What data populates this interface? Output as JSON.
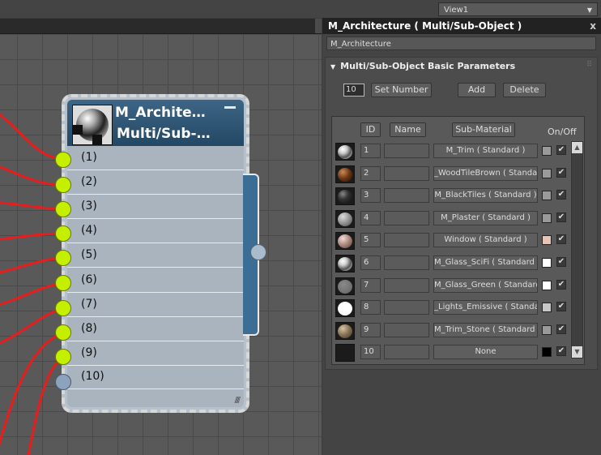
{
  "view_dropdown": {
    "selected": "View1"
  },
  "node": {
    "title": "M_Archite…",
    "subtitle": "Multi/Sub-…",
    "slots": [
      "(1)",
      "(2)",
      "(3)",
      "(4)",
      "(5)",
      "(6)",
      "(7)",
      "(8)",
      "(9)",
      "(10)"
    ],
    "port_color": "#c4f000",
    "empty_port_color": "#8da2bd",
    "header_color": "#2d5576",
    "wire_color": "#e81d1d"
  },
  "panel": {
    "title": "M_Architecture  ( Multi/Sub-Object )",
    "close_label": "x",
    "material_name": "M_Architecture",
    "rollout_title": "Multi/Sub-Object Basic Parameters",
    "number_value": "10",
    "set_number_label": "Set Number",
    "add_label": "Add",
    "delete_label": "Delete",
    "headers": {
      "id": "ID",
      "name": "Name",
      "sub_material": "Sub-Material",
      "on_off": "On/Off"
    },
    "rows": [
      {
        "id": "1",
        "sub": "M_Trim  ( Standard )",
        "color": "#9a9a9a",
        "on": true,
        "ball": "chrome"
      },
      {
        "id": "2",
        "sub": "_WoodTileBrown  ( Standard )",
        "color": "#9a9a9a",
        "on": true,
        "ball": "wood"
      },
      {
        "id": "3",
        "sub": "M_BlackTiles  ( Standard )",
        "color": "#9a9a9a",
        "on": true,
        "ball": "dark"
      },
      {
        "id": "4",
        "sub": "M_Plaster  ( Standard )",
        "color": "#9a9a9a",
        "on": true,
        "ball": "grey"
      },
      {
        "id": "5",
        "sub": "Window  ( Standard )",
        "color": "#e8c4b6",
        "on": true,
        "ball": "pink"
      },
      {
        "id": "6",
        "sub": "M_Glass_SciFi  ( Standard )",
        "color": "#ffffff",
        "on": true,
        "ball": "chrome"
      },
      {
        "id": "7",
        "sub": "M_Glass_Green  ( Standard )",
        "color": "#ffffff",
        "on": true,
        "ball": "flat"
      },
      {
        "id": "8",
        "sub": "_Lights_Emissive  ( Standard )",
        "color": "#c8c8c8",
        "on": true,
        "ball": "white"
      },
      {
        "id": "9",
        "sub": "M_Trim_Stone  ( Standard )",
        "color": "#9a9a9a",
        "on": true,
        "ball": "stone"
      },
      {
        "id": "10",
        "sub": "None",
        "color": "#000000",
        "on": true,
        "ball": "none"
      }
    ],
    "check_glyph": "✔"
  }
}
